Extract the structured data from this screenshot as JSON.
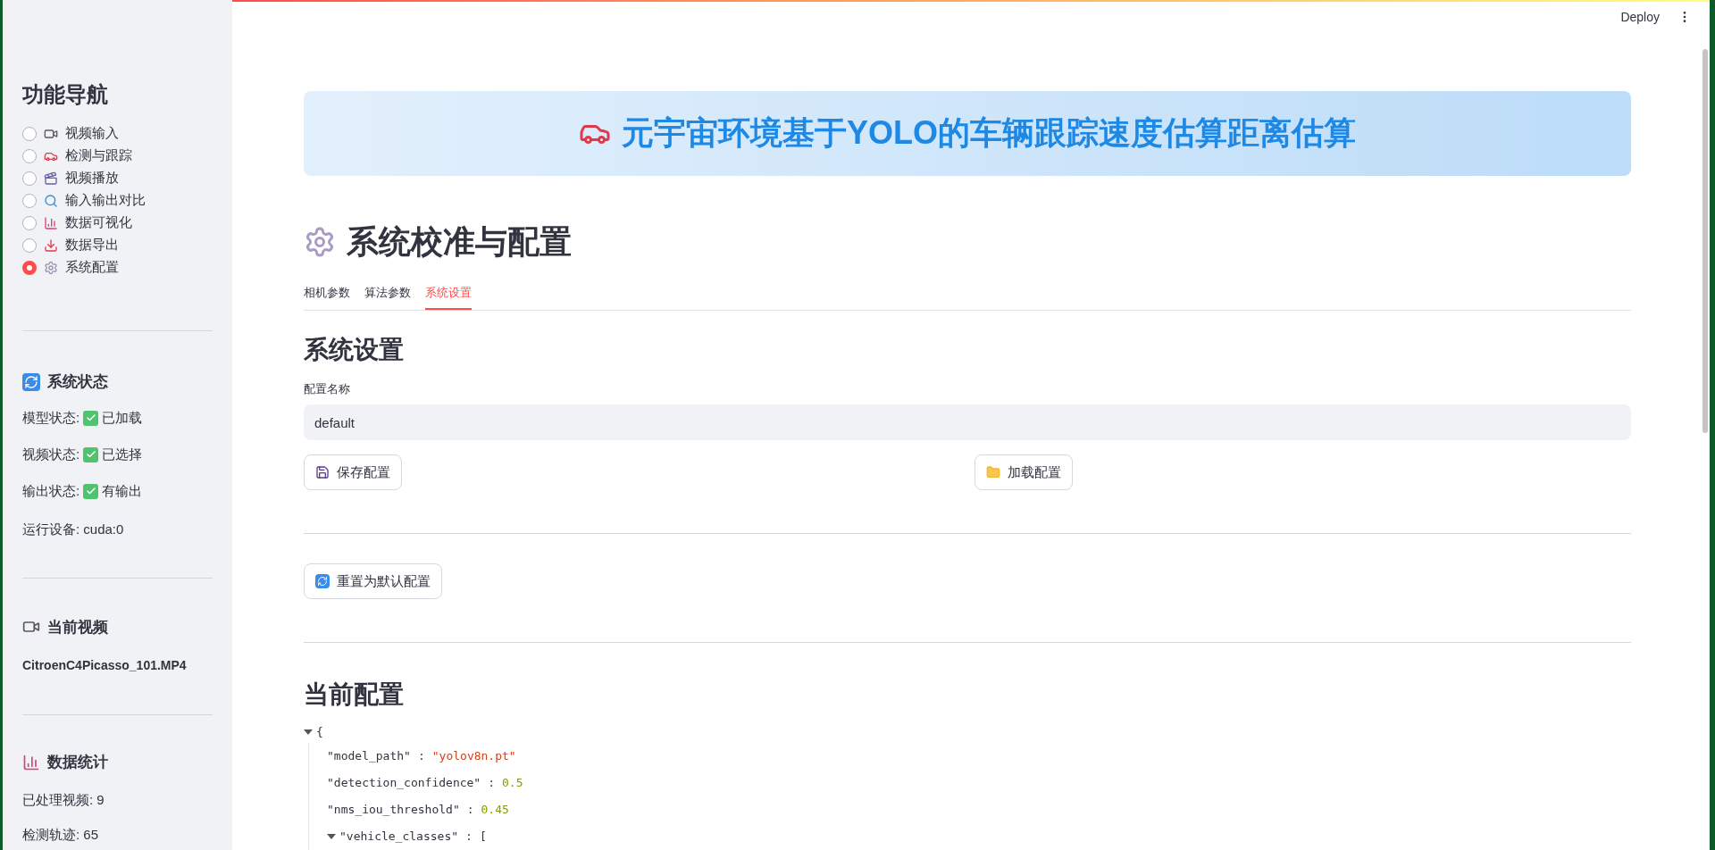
{
  "sidebar": {
    "title": "功能导航",
    "nav": [
      {
        "label": "视频输入",
        "selected": false
      },
      {
        "label": "检测与跟踪",
        "selected": false
      },
      {
        "label": "视频播放",
        "selected": false
      },
      {
        "label": "输入输出对比",
        "selected": false
      },
      {
        "label": "数据可视化",
        "selected": false
      },
      {
        "label": "数据导出",
        "selected": false
      },
      {
        "label": "系统配置",
        "selected": true
      }
    ],
    "status": {
      "heading": "系统状态",
      "lines": [
        {
          "label": "模型状态:",
          "checked": true,
          "value": "已加载"
        },
        {
          "label": "视频状态:",
          "checked": true,
          "value": "已选择"
        },
        {
          "label": "输出状态:",
          "checked": true,
          "value": "有输出"
        }
      ],
      "device": "运行设备: cuda:0"
    },
    "current_video": {
      "heading": "当前视频",
      "filename": "CitroenC4Picasso_101.MP4"
    },
    "stats": {
      "heading": "数据统计",
      "lines": [
        "已处理视频: 9",
        "检测轨迹: 65"
      ]
    }
  },
  "toolbar": {
    "deploy": "Deploy"
  },
  "banner": {
    "title": "元宇宙环境基于YOLO的车辆跟踪速度估算距离估算"
  },
  "page_title": "系统校准与配置",
  "tabs": [
    {
      "label": "相机参数",
      "selected": false
    },
    {
      "label": "算法参数",
      "selected": false
    },
    {
      "label": "系统设置",
      "selected": true
    }
  ],
  "settings": {
    "heading": "系统设置",
    "field": {
      "label": "配置名称",
      "value": "default"
    },
    "buttons": [
      "保存配置",
      "加载配置"
    ],
    "reset_button": "重置为默认配置"
  },
  "current_config": {
    "heading": "当前配置",
    "open_brace": "{",
    "expanded": true,
    "entries": [
      {
        "key": "\"model_path\"",
        "colon": ":",
        "kind": "string",
        "value": "\"yolov8n.pt\""
      },
      {
        "key": "\"detection_confidence\"",
        "colon": ":",
        "kind": "number",
        "value": "0.5"
      },
      {
        "key": "\"nms_iou_threshold\"",
        "colon": ":",
        "kind": "number",
        "value": "0.45"
      },
      {
        "key": "\"vehicle_classes\"",
        "colon": ":",
        "kind": "array",
        "expanded": true,
        "value": "["
      }
    ]
  }
}
